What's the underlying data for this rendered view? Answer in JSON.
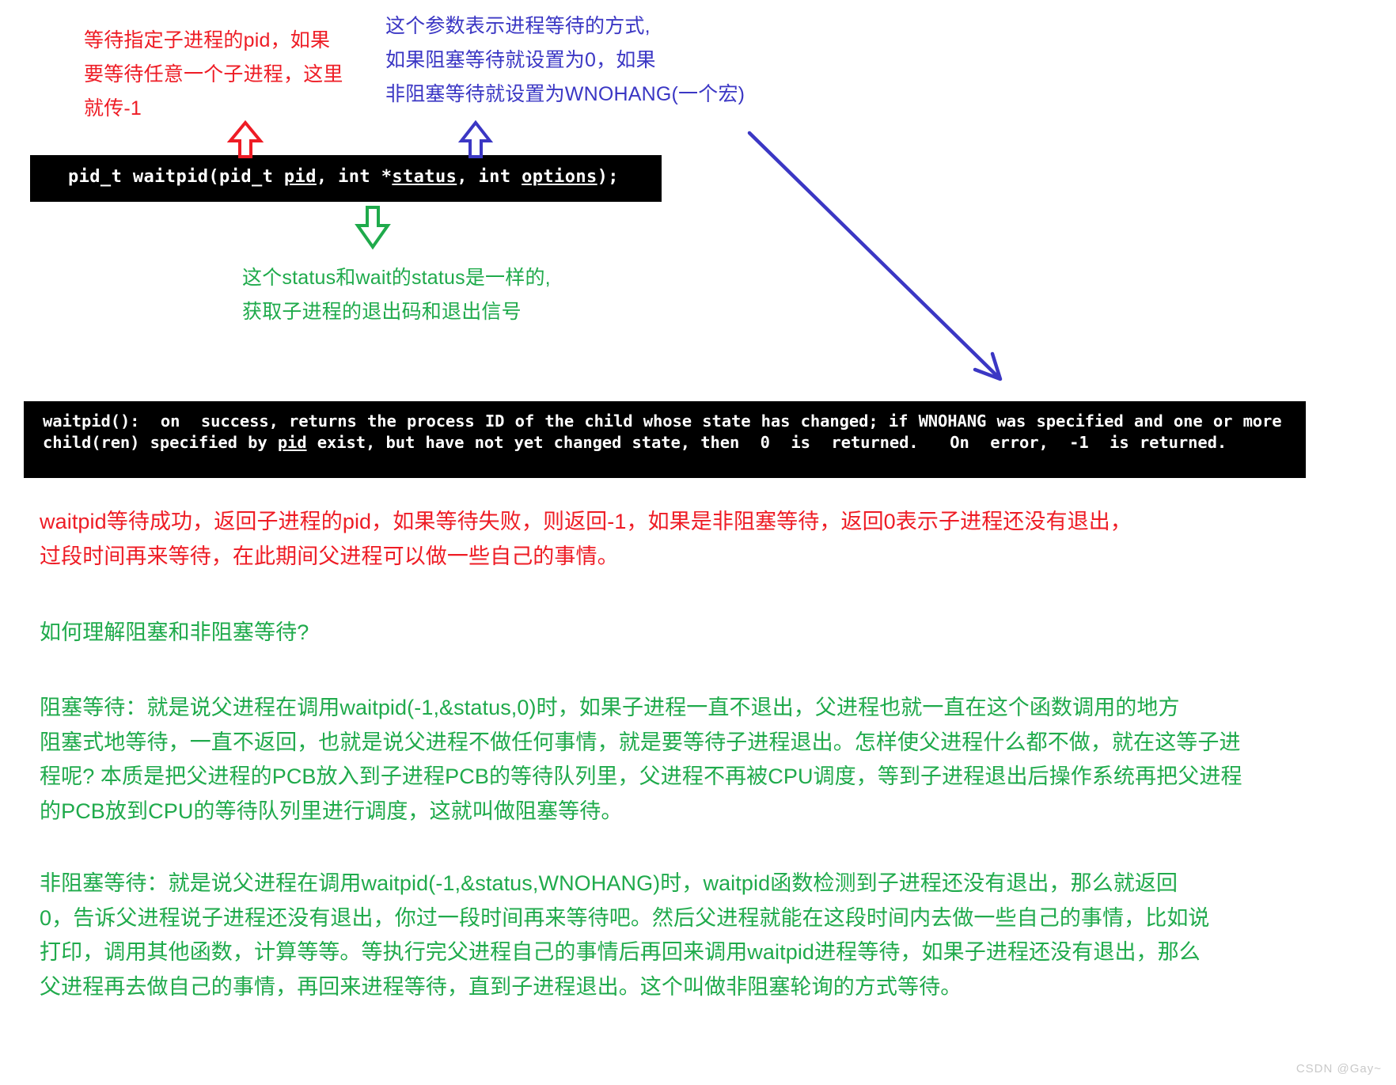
{
  "colors": {
    "red": "#ee1c25",
    "blue": "#3b37c4",
    "green": "#1faa4b",
    "code_bg": "#000000",
    "code_fg": "#ffffff",
    "page_bg": "#ffffff",
    "watermark": "#c9c9c9"
  },
  "annotations": {
    "pid_note": "等待指定子进程的pid，如果\n要等待任意一个子进程，这里\n就传-1",
    "options_note": "这个参数表示进程等待的方式,\n如果阻塞等待就设置为0，如果\n非阻塞等待就设置为WNOHANG(一个宏)",
    "status_note": "这个status和wait的status是一样的,\n获取子进程的退出码和退出信号"
  },
  "signature": {
    "prefix": "pid_t waitpid(pid_t ",
    "arg1": "pid",
    "mid1": ", int *",
    "arg2": "status",
    "mid2": ", int ",
    "arg3": "options",
    "suffix": ");",
    "full": "pid_t waitpid(pid_t pid, int *status, int options);"
  },
  "manpage": {
    "fn": "waitpid",
    "line1_a": "(): ",
    "line1_b": " on  success, returns the process ID of the child whose state has changed; if ",
    "wnohang": "WNOHANG",
    "line1_c": " was specified and one",
    "line2_a": "or more child(ren) specified by ",
    "pid": "pid",
    "line2_b": " exist, but have not yet changed state, then  0  is  returned.   On  error,  -1  is",
    "line3": "returned.",
    "full": "waitpid():  on  success, returns the process ID of the child whose state has changed; if WNOHANG was specified and one or more child(ren) specified by pid exist, but have not yet changed state, then  0  is  returned.   On  error,  -1  is returned."
  },
  "paragraphs": {
    "return_value": "waitpid等待成功，返回子进程的pid，如果等待失败，则返回-1，如果是非阻塞等待，返回0表示子进程还没有退出，\n过段时间再来等待，在此期间父进程可以做一些自己的事情。",
    "question": "如何理解阻塞和非阻塞等待?",
    "blocking": "阻塞等待：就是说父进程在调用waitpid(-1,&status,0)时，如果子进程一直不退出，父进程也就一直在这个函数调用的地方\n阻塞式地等待，一直不返回，也就是说父进程不做任何事情，就是要等待子进程退出。怎样使父进程什么都不做，就在这等子进\n程呢? 本质是把父进程的PCB放入到子进程PCB的等待队列里，父进程不再被CPU调度，等到子进程退出后操作系统再把父进程\n的PCB放到CPU的等待队列里进行调度，这就叫做阻塞等待。",
    "nonblocking": "非阻塞等待：就是说父进程在调用waitpid(-1,&status,WNOHANG)时，waitpid函数检测到子进程还没有退出，那么就返回\n0，告诉父进程说子进程还没有退出，你过一段时间再来等待吧。然后父进程就能在这段时间内去做一些自己的事情，比如说\n打印，调用其他函数，计算等等。等执行完父进程自己的事情后再回来调用waitpid进程等待，如果子进程还没有退出，那么\n父进程再去做自己的事情，再回来进程等待，直到子进程退出。这个叫做非阻塞轮询的方式等待。"
  },
  "watermark": "CSDN @Gay~"
}
